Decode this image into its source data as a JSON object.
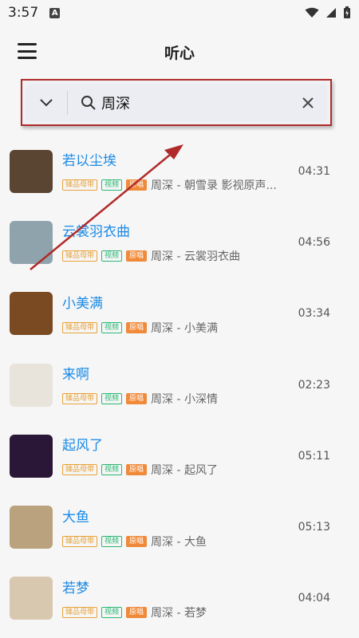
{
  "status": {
    "time": "3:57",
    "badge": "A"
  },
  "header": {
    "title": "听心"
  },
  "search": {
    "query": "周深"
  },
  "tags": {
    "master": "臻品母带",
    "video": "视频",
    "original": "原唱"
  },
  "songs": [
    {
      "title": "若以尘埃",
      "artist": "周深 - 朝雪录 影视原声...",
      "duration": "04:31",
      "cover": "#5a4432"
    },
    {
      "title": "云裳羽衣曲",
      "artist": "周深 - 云裳羽衣曲",
      "duration": "04:56",
      "cover": "#8fa3ad"
    },
    {
      "title": "小美满",
      "artist": "周深 - 小美满",
      "duration": "03:34",
      "cover": "#7a4a22"
    },
    {
      "title": "来啊",
      "artist": "周深 - 小深情",
      "duration": "02:23",
      "cover": "#e8e4dc"
    },
    {
      "title": "起风了",
      "artist": "周深 - 起风了",
      "duration": "05:11",
      "cover": "#2a1636"
    },
    {
      "title": "大鱼",
      "artist": "周深 - 大鱼",
      "duration": "05:13",
      "cover": "#b9a27d"
    },
    {
      "title": "若梦",
      "artist": "周深 - 若梦",
      "duration": "04:04",
      "cover": "#d9c8b0"
    }
  ],
  "colors": {
    "accent": "#1a8ae6",
    "annotation": "#b12a2a"
  }
}
